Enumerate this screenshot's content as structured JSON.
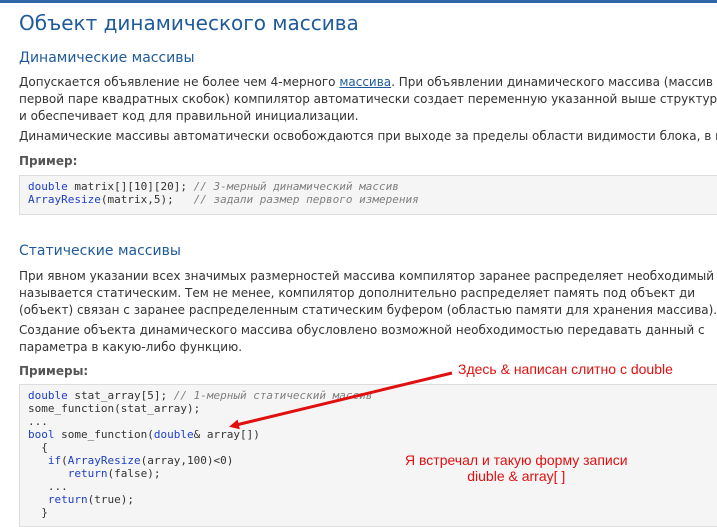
{
  "page": {
    "title": "Объект динамического массива"
  },
  "dynamic": {
    "heading": "Динамические массивы",
    "para1_line1_a": "Допускается объявление не более чем 4-мерного ",
    "para1_link": "массива",
    "para1_line1_b": ". При объявлении динамического массива (массив",
    "para1_line2": "первой паре квадратных скобок) компилятор автоматически создает переменную указанной выше структуры (д",
    "para1_line3": "и обеспечивает код для правильной инициализации.",
    "para2": "Динамические массивы автоматически освобождаются при выходе за пределы области видимости блока, в кото",
    "example_label": "Пример:",
    "code": [
      {
        "kw": "double",
        "rest": " matrix[][10][20]; ",
        "cm": "// 3-мерный динамический массив"
      },
      {
        "fn": "ArrayResize",
        "rest": "(matrix,5);   ",
        "cm": "// задали размер первого измерения"
      }
    ]
  },
  "static": {
    "heading": "Статические массивы",
    "para1_line1": "При явном указании всех значимых размерностей массива компилятор заранее распределяет необходимый",
    "para1_line2": "называется статическим. Тем не менее, компилятор дополнительно распределяет память под объект ди",
    "para1_line3": "(объект) связан с заранее распределенным статическим буфером (областью памяти для хранения массива).",
    "para2_line1": "Создание объекта динамического массива обусловлено возможной необходимостью передавать данный с",
    "para2_line2": "параметра в какую-либо функцию.",
    "example_label": "Примеры:",
    "code": {
      "l1_kw": "double",
      "l1_rest": " stat_array[5]; ",
      "l1_cm": "// 1-мерный статический массив",
      "l2": "some_function(stat_array);",
      "l3": "...",
      "l4_kw": "bool",
      "l4_a": " some_function(",
      "l4_kw2": "double",
      "l4_b": "& array[])",
      "l5": "  {",
      "l6_kw": "if",
      "l6_a": "(",
      "l6_fn": "ArrayResize",
      "l6_b": "(array,100)<0)",
      "l7_kw": "return",
      "l7_rest": "(false);",
      "l8": "   ...",
      "l9_kw": "return",
      "l9_rest": "(true);",
      "l10": "  }"
    }
  },
  "annotations": {
    "note1": "Здесь & написан слитно с double",
    "note2_line1": "Я встречал и такую форму записи",
    "note2_line2": "diuble & array[ ]",
    "color": "#e01010"
  }
}
